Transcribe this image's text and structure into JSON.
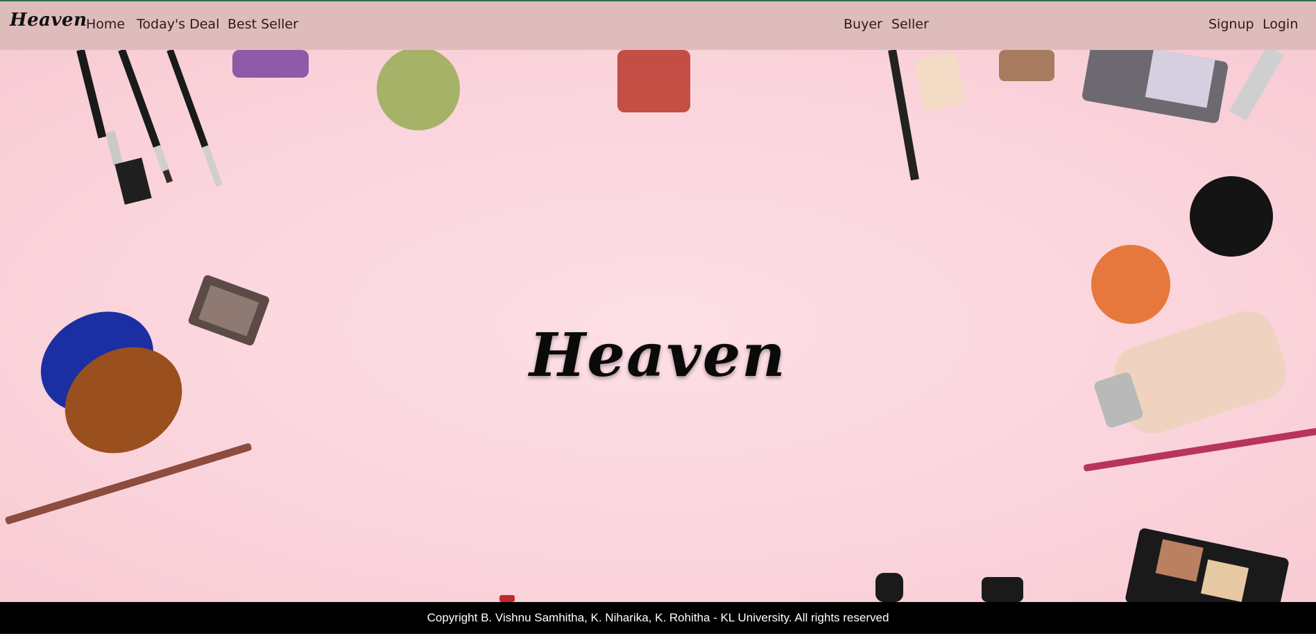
{
  "navbar": {
    "brand": "Heaven",
    "left_links": [
      "Home",
      "Today's Deal",
      "Best Seller"
    ],
    "center_links": [
      "Buyer",
      "Seller"
    ],
    "right_links": [
      "Signup",
      "Login"
    ]
  },
  "hero": {
    "title": "Heaven",
    "background_image": "makeup-flatlay-image"
  },
  "footer": {
    "copyright": "Copyright B. Vishnu Samhitha, K. Niharika, K. Rohitha - KL University. All rights reserved"
  },
  "colors": {
    "navbar_bg": "#dfbcbc",
    "hero_bg": "#fbd5dd",
    "footer_bg": "#000000",
    "footer_text": "#ffffff"
  }
}
